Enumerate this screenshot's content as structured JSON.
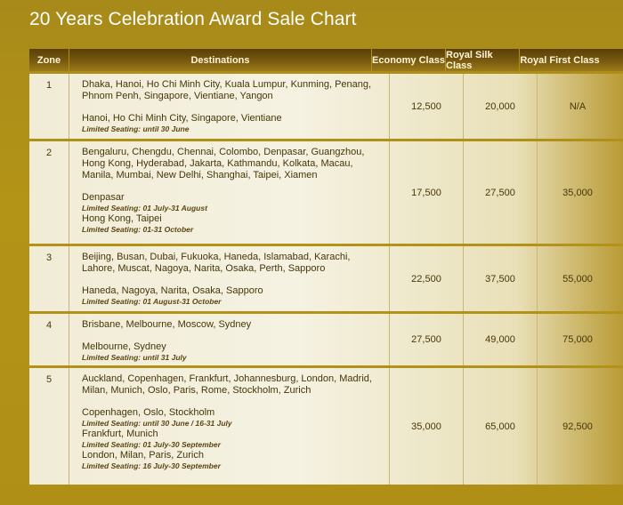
{
  "title": "20 Years Celebration Award Sale Chart",
  "headers": {
    "zone": "Zone",
    "destinations": "Destinations",
    "economy": "Economy Class",
    "silk": "Royal Silk Class",
    "first": "Royal First Class"
  },
  "rows": [
    {
      "zone": "1",
      "dest1": "Dhaka, Hanoi, Ho Chi Minh City, Kuala Lumpur, Kunming, Penang, Phnom Penh, Singapore, Vientiane, Yangon",
      "lines": [
        {
          "city": "Hanoi, Ho Chi Minh City, Singapore, Vientiane",
          "note": "Limited Seating: until 30 June"
        }
      ],
      "economy": "12,500",
      "silk": "20,000",
      "first": "N/A"
    },
    {
      "zone": "2",
      "dest1": "Bengaluru, Chengdu, Chennai, Colombo, Denpasar, Guangzhou, Hong Kong, Hyderabad, Jakarta, Kathmandu, Kolkata, Macau, Manila, Mumbai, New Delhi, Shanghai, Taipei, Xiamen",
      "lines": [
        {
          "city": "Denpasar",
          "note": "Limited Seating: 01 July-31 August"
        },
        {
          "city": "Hong Kong, Taipei",
          "note": "Limited Seating: 01-31 October"
        }
      ],
      "economy": "17,500",
      "silk": "27,500",
      "first": "35,000"
    },
    {
      "zone": "3",
      "dest1": "Beijing, Busan, Dubai, Fukuoka, Haneda, Islamabad, Karachi, Lahore, Muscat, Nagoya, Narita, Osaka, Perth, Sapporo",
      "lines": [
        {
          "city": "Haneda, Nagoya, Narita, Osaka, Sapporo",
          "note": "Limited Seating: 01 August-31 October"
        }
      ],
      "economy": "22,500",
      "silk": "37,500",
      "first": "55,000"
    },
    {
      "zone": "4",
      "dest1": "Brisbane, Melbourne, Moscow, Sydney",
      "lines": [
        {
          "city": "Melbourne, Sydney",
          "note": "Limited Seating: until 31 July"
        }
      ],
      "economy": "27,500",
      "silk": "49,000",
      "first": "75,000"
    },
    {
      "zone": "5",
      "dest1": "Auckland, Copenhagen, Frankfurt, Johannesburg, London, Madrid, Milan, Munich, Oslo, Paris, Rome, Stockholm, Zurich",
      "lines": [
        {
          "city": "Copenhagen, Oslo, Stockholm",
          "note": "Limited Seating: until 30 June / 16-31 July"
        },
        {
          "city": "Frankfurt, Munich",
          "note": "Limited Seating: 01 July-30 September"
        },
        {
          "city": "London, Milan, Paris, Zurich",
          "note": "Limited Seating: 16 July-30 September"
        }
      ],
      "economy": "35,000",
      "silk": "65,000",
      "first": "92,500"
    }
  ]
}
